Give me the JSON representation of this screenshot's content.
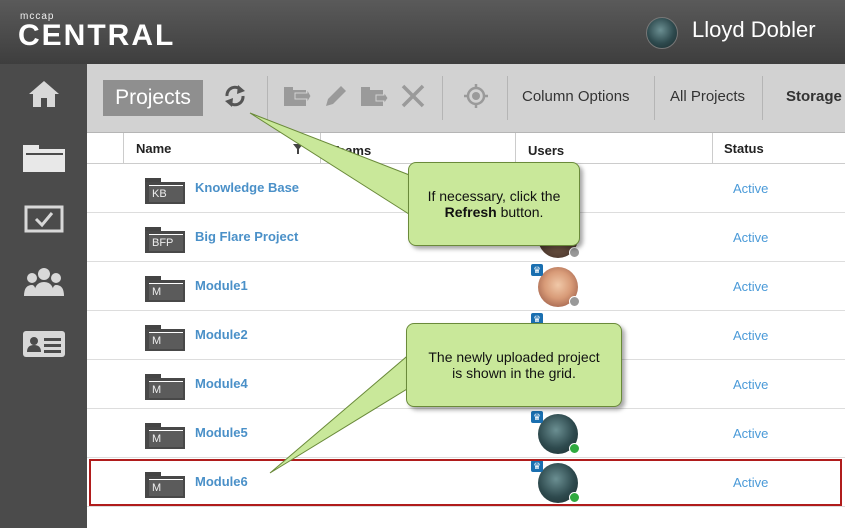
{
  "header": {
    "logo_small": "mccap",
    "logo_big": "CENTRAL",
    "user_name": "Lloyd Dobler"
  },
  "sidebar": {
    "items": [
      {
        "icon": "home-icon"
      },
      {
        "icon": "folder-icon"
      },
      {
        "icon": "checkbox-icon"
      },
      {
        "icon": "users-icon"
      },
      {
        "icon": "id-card-icon"
      }
    ]
  },
  "toolbar": {
    "projects_label": "Projects",
    "column_options": "Column Options",
    "all_projects": "All Projects",
    "storage": "Storage"
  },
  "grid": {
    "columns": [
      "Name",
      "Teams",
      "Users",
      "Status"
    ],
    "rows": [
      {
        "abbr": "KB",
        "name": "Knowledge Base",
        "status": "Active"
      },
      {
        "abbr": "BFP",
        "name": "Big Flare Project",
        "status": "Active"
      },
      {
        "abbr": "M",
        "name": "Module1",
        "status": "Active"
      },
      {
        "abbr": "M",
        "name": "Module2",
        "status": "Active"
      },
      {
        "abbr": "M",
        "name": "Module4",
        "status": "Active"
      },
      {
        "abbr": "M",
        "name": "Module5",
        "status": "Active"
      },
      {
        "abbr": "M",
        "name": "Module6",
        "status": "Active"
      }
    ]
  },
  "callouts": {
    "refresh_line1": "If necessary, click the",
    "refresh_bold": "Refresh",
    "refresh_line2_rest": " button.",
    "uploaded_line1": "The newly uploaded project",
    "uploaded_line2": "is shown in the grid."
  },
  "colors": {
    "link": "#4a90c8",
    "status": "#4a9ad8",
    "callout_bg": "#c9e89a",
    "highlight": "#b01c1c"
  }
}
